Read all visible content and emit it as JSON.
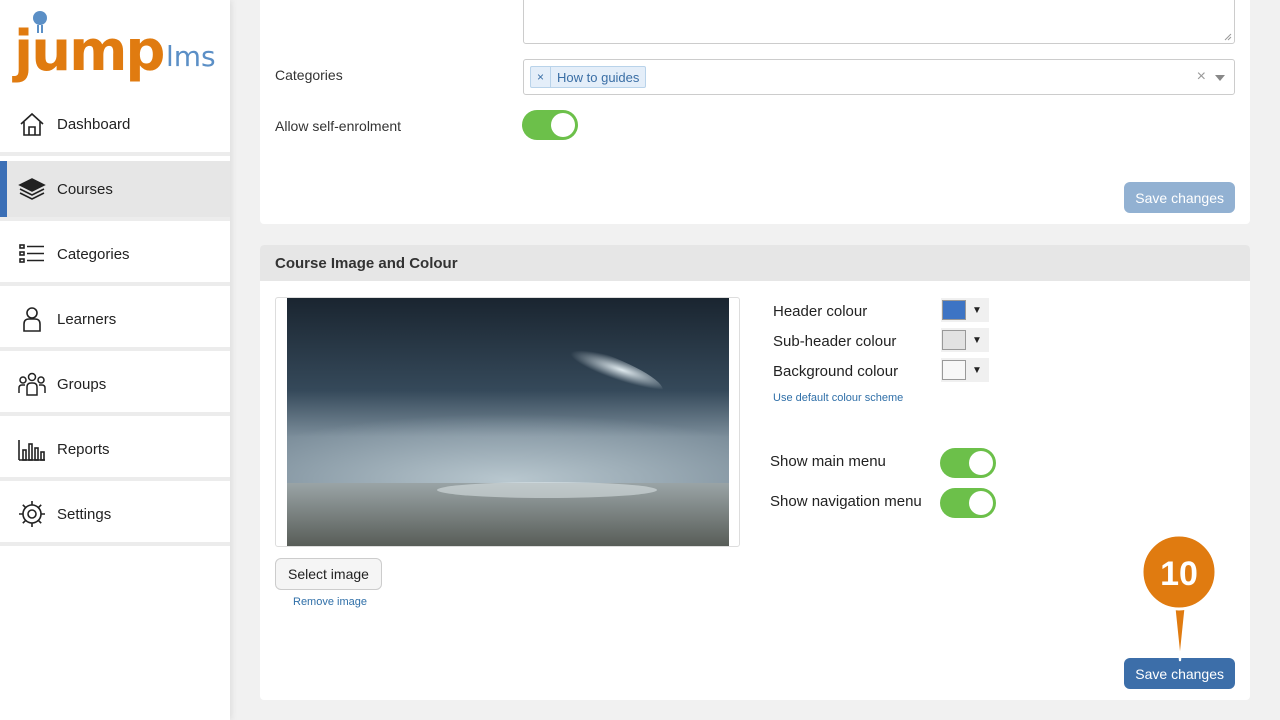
{
  "brand": {
    "logo_jump": "jump",
    "logo_lms": "lms"
  },
  "sidebar": {
    "items": [
      {
        "label": "Dashboard",
        "icon": "home-icon"
      },
      {
        "label": "Courses",
        "icon": "books-icon",
        "active": true
      },
      {
        "label": "Categories",
        "icon": "list-icon"
      },
      {
        "label": "Learners",
        "icon": "person-icon"
      },
      {
        "label": "Groups",
        "icon": "group-icon"
      },
      {
        "label": "Reports",
        "icon": "bar-chart-icon"
      },
      {
        "label": "Settings",
        "icon": "gear-icon"
      }
    ]
  },
  "settings_card": {
    "categories_label": "Categories",
    "category_tag": "How to guides",
    "tag_remove": "×",
    "clear": "×",
    "self_enrol_label": "Allow self-enrolment",
    "self_enrol_on": true,
    "save_label": "Save changes"
  },
  "image_card": {
    "title": "Course Image and Colour",
    "select_image": "Select image",
    "remove_image": "Remove image",
    "header_colour_label": "Header colour",
    "header_colour": "#3d74c4",
    "subheader_colour_label": "Sub-header colour",
    "subheader_colour": "#e2e2e2",
    "background_colour_label": "Background colour",
    "background_colour": "#f7f7f7",
    "default_scheme_link": "Use default colour scheme",
    "show_main_menu_label": "Show main menu",
    "show_main_menu_on": true,
    "show_nav_menu_label": "Show navigation menu",
    "show_nav_menu_on": true,
    "save_label": "Save changes"
  },
  "callout": {
    "step": "10",
    "color": "#e07b10"
  },
  "colors": {
    "accent": "#3c6ea9",
    "toggle_on": "#6cc04a",
    "brand_orange": "#e07b10",
    "brand_blue": "#5b8fc6"
  }
}
